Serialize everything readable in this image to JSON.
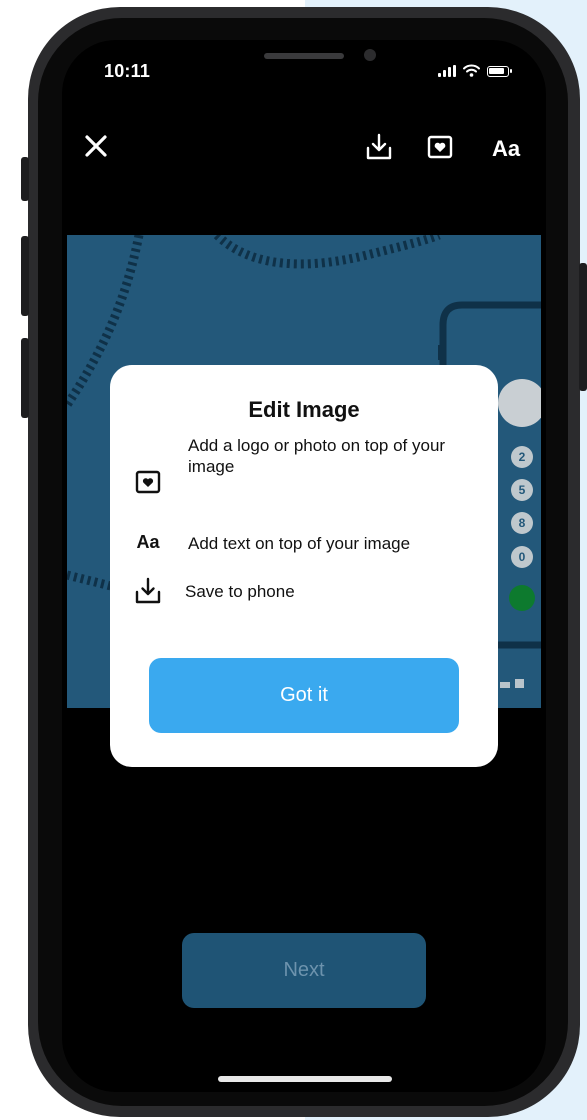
{
  "status_bar": {
    "time": "10:11"
  },
  "toolbar": {
    "close_icon": "close-icon",
    "save_icon": "download-icon",
    "logo_icon": "heart-square-icon",
    "text_button_label": "Aa"
  },
  "image": {
    "badge_numbers": [
      "2",
      "5",
      "8",
      "0"
    ]
  },
  "modal": {
    "title": "Edit Image",
    "features": [
      {
        "icon": "heart-square-icon",
        "text": "Add a logo or photo on top of your image"
      },
      {
        "icon": "text-icon",
        "icon_label": "Aa",
        "text": "Add text on top of your image"
      },
      {
        "icon": "download-icon",
        "text": "Save to phone"
      }
    ],
    "button_label": "Got it"
  },
  "footer": {
    "next_label": "Next"
  },
  "colors": {
    "accent": "#3aa9ef",
    "next_button": "#1f5475",
    "image_background": "#23587a",
    "page_side_panel": "#e3f1fb"
  }
}
